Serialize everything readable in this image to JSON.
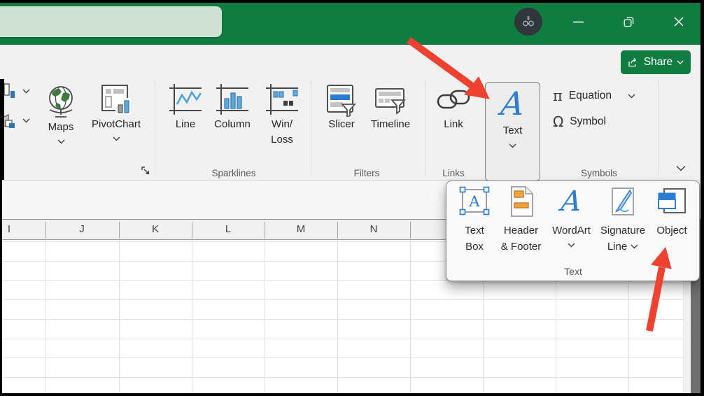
{
  "titlebar": {
    "search_value": ""
  },
  "share": {
    "label": "Share"
  },
  "ribbon": {
    "buttons": {
      "maps": "Maps",
      "pivotchart": "PivotChart",
      "line": "Line",
      "column": "Column",
      "winloss_line1": "Win/",
      "winloss_line2": "Loss",
      "slicer": "Slicer",
      "timeline": "Timeline",
      "link": "Link",
      "text": "Text",
      "equation": "Equation",
      "symbol": "Symbol"
    },
    "group_labels": {
      "sparklines": "Sparklines",
      "filters": "Filters",
      "links": "Links",
      "symbols": "Symbols"
    }
  },
  "icons": {
    "equation_glyph": "π",
    "symbol_glyph": "Ω",
    "wordart_glyph": "A",
    "textbox_glyph": "A"
  },
  "text_menu": {
    "items": [
      {
        "line1": "Text",
        "line2": "Box"
      },
      {
        "line1": "Header",
        "line2": "& Footer"
      },
      {
        "line1": "WordArt",
        "line2": ""
      },
      {
        "line1": "Signature",
        "line2": "Line"
      },
      {
        "line1": "Object",
        "line2": ""
      }
    ],
    "group_label": "Text"
  },
  "sheet": {
    "columns": [
      "I",
      "J",
      "K",
      "L",
      "M",
      "N"
    ]
  },
  "colors": {
    "excel_green": "#107C41",
    "accent_blue": "#2B7CD3",
    "arrow_red": "#EF4130"
  }
}
